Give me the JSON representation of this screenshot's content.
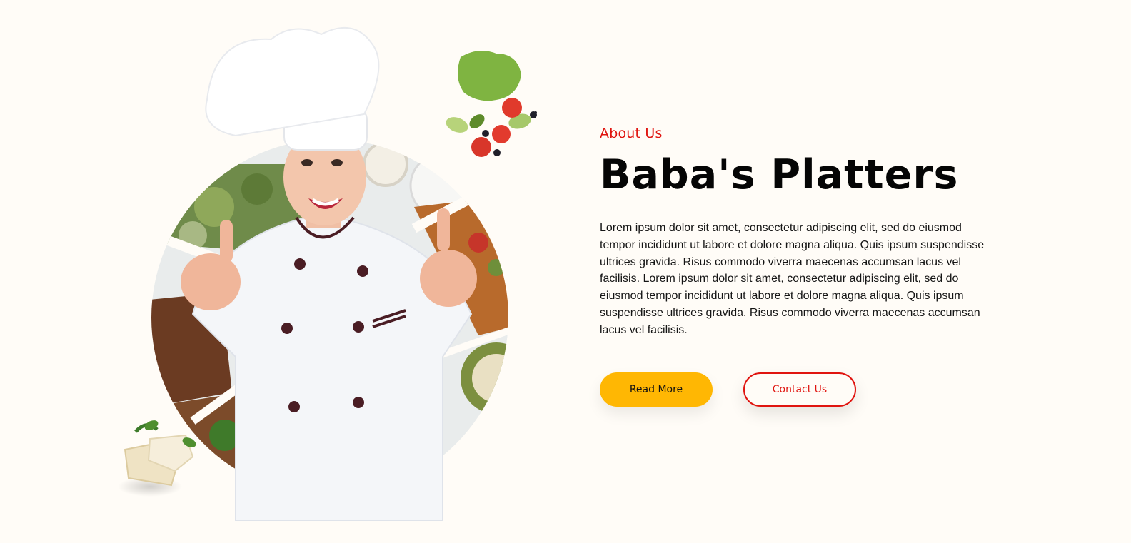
{
  "about": {
    "eyebrow": "About Us",
    "title": "Baba's Platters",
    "description": "Lorem ipsum dolor sit amet, consectetur adipiscing elit, sed do eiusmod tempor incididunt ut labore et dolore magna aliqua. Quis ipsum suspendisse ultrices gravida. Risus commodo viverra maecenas accumsan lacus vel facilisis. Lorem ipsum dolor sit amet, consectetur adipiscing elit, sed do eiusmod tempor incididunt ut labore et dolore magna aliqua. Quis ipsum suspendisse ultrices gravida. Risus commodo viverra maecenas accumsan lacus vel facilisis.",
    "read_more_label": "Read More",
    "contact_label": "Contact Us"
  },
  "colors": {
    "accent_red": "#e0140f",
    "accent_yellow": "#ffb703",
    "background": "#fffcf7"
  },
  "images": {
    "hero": "chef-thumbs-up-food-circle-image",
    "salad_decor": "salad-leaf-tomato-decoration",
    "tofu_decor": "tofu-basil-decoration"
  }
}
